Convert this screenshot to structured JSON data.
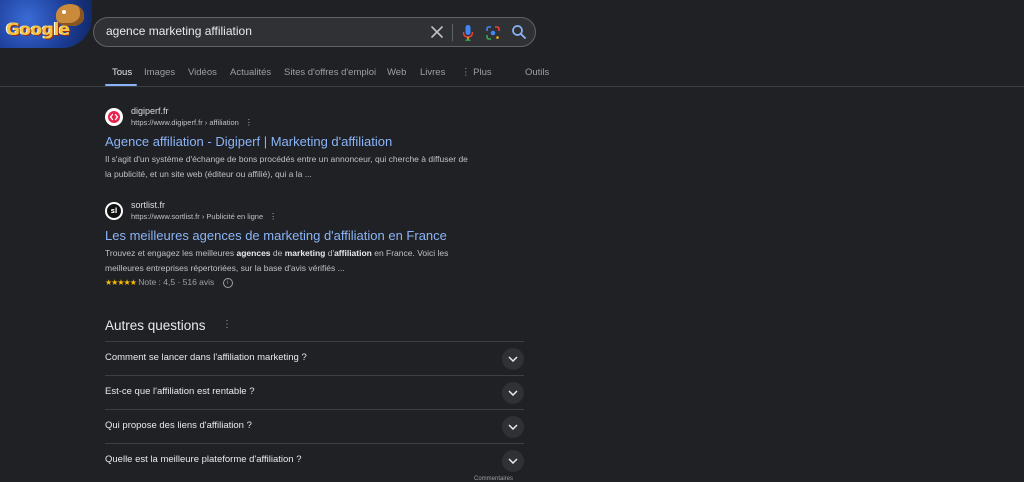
{
  "logo": {
    "text": "Google"
  },
  "search": {
    "query": "agence marketing affiliation",
    "placeholder": ""
  },
  "tabs": [
    {
      "label": "Tous",
      "active": true
    },
    {
      "label": "Images"
    },
    {
      "label": "Vidéos"
    },
    {
      "label": "Actualités"
    },
    {
      "label": "Sites d'offres d'emploi"
    },
    {
      "label": "Web"
    },
    {
      "label": "Livres"
    },
    {
      "label": "⋮ Plus"
    },
    {
      "label": "Outils"
    }
  ],
  "results": [
    {
      "site_name": "digiperf.fr",
      "url": "https://www.digiperf.fr › affiliation",
      "title": "Agence affiliation - Digiperf | Marketing d'affiliation",
      "snippet_line1": "Il s'agit d'un système d'échange de bons procédés entre un annonceur, qui cherche à diffuser de",
      "snippet_line2": "la publicité, et un site web (éditeur ou affilié), qui a la ..."
    },
    {
      "site_name": "sortlist.fr",
      "favicon_text": "sl",
      "url": "https://www.sortlist.fr › Publicité en ligne",
      "title": "Les meilleures agences de marketing d'affiliation en France",
      "snippet_line1_a": "Trouvez et engagez les meilleures ",
      "snippet_line1_b": "agences",
      "snippet_line1_c": " de ",
      "snippet_line1_d": "marketing",
      "snippet_line1_e": " d'",
      "snippet_line1_f": "affiliation",
      "snippet_line1_g": " en France. Voici les",
      "snippet_line2": "meilleures entreprises répertoriées, sur la base d'avis vérifiés ...",
      "stars": "★★★★★",
      "rating_text": "Note : 4,5 · 516 avis",
      "rating_value": 4.5
    }
  ],
  "paa": {
    "title": "Autres questions",
    "questions": [
      "Comment se lancer dans l'affiliation marketing ?",
      "Est-ce que l'affiliation est rentable ?",
      "Qui propose des liens d'affiliation ?",
      "Quelle est la meilleure plateforme d'affiliation ?"
    ],
    "feedback": "Commentaires"
  },
  "colors": {
    "background": "#202124",
    "link": "#8ab4f8",
    "star": "#fbbc04"
  }
}
